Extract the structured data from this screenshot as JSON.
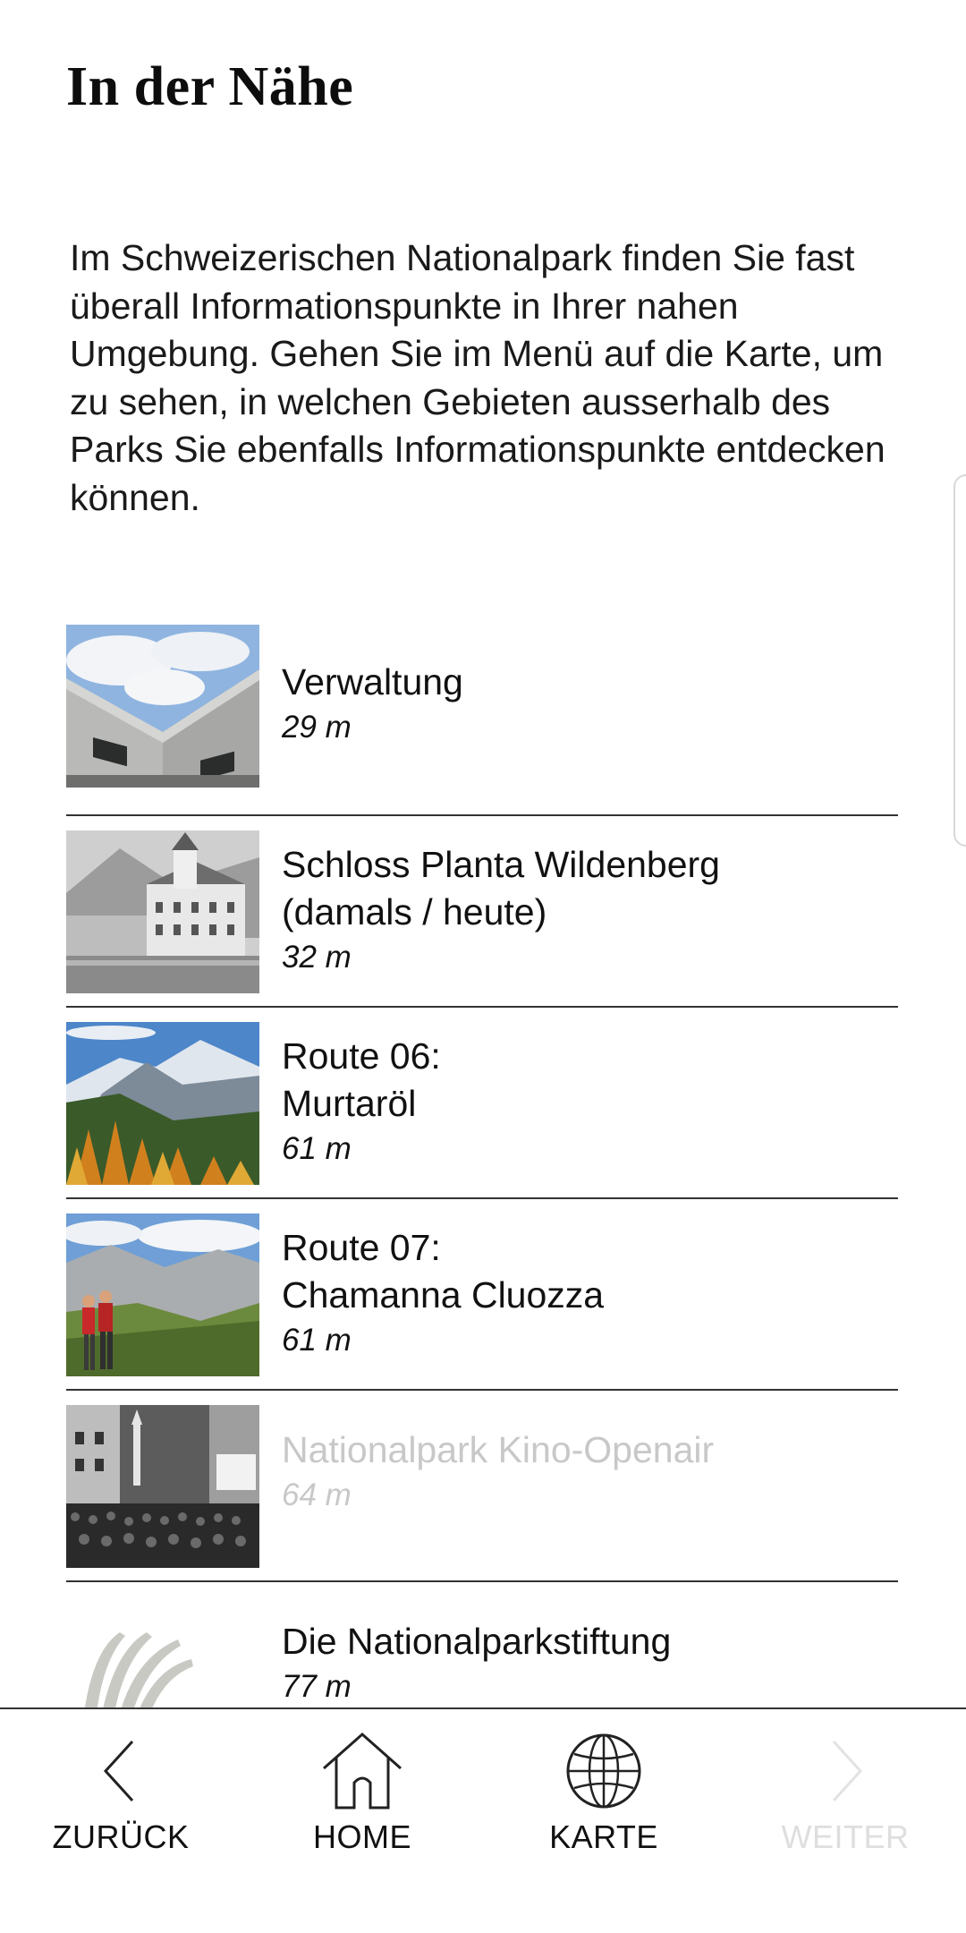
{
  "header": {
    "title": "In der Nähe"
  },
  "intro": "Im Schweizerischen Nationalpark finden Sie fast überall Informationspunkte in Ihrer nahen Umgebung. Gehen Sie im Menü auf die Karte, um zu sehen, in welchen Gebieten ausserhalb des Parks Sie ebenfalls Informationspunkte entdecken können.",
  "list": {
    "items": [
      {
        "title": "Verwaltung",
        "distance": "29 m",
        "image": "building-architecture-photo",
        "enabled": true
      },
      {
        "title": "Schloss Planta Wildenberg\n(damals / heute)",
        "distance": "32 m",
        "image": "castle-historic-photo",
        "enabled": true
      },
      {
        "title": "Route 06:\nMurtaröl",
        "distance": "61 m",
        "image": "mountain-autumn-photo",
        "enabled": true
      },
      {
        "title": "Route 07:\nChamanna Cluozza",
        "distance": "61 m",
        "image": "hikers-valley-photo",
        "enabled": true
      },
      {
        "title": "Nationalpark Kino-Openair",
        "distance": "64 m",
        "image": "open-air-cinema-photo",
        "enabled": false
      },
      {
        "title": "Die Nationalparkstiftung",
        "distance": "77 m",
        "image": "foundation-logo",
        "enabled": true
      }
    ]
  },
  "nav": {
    "back": {
      "label": "ZURÜCK",
      "icon": "chevron-left-icon",
      "enabled": true
    },
    "home": {
      "label": "HOME",
      "icon": "home-icon",
      "enabled": true
    },
    "map": {
      "label": "KARTE",
      "icon": "globe-icon",
      "enabled": true
    },
    "next": {
      "label": "WEITER",
      "icon": "chevron-right-icon",
      "enabled": false
    }
  },
  "colors": {
    "text": "#111111",
    "disabled": "#c8c8c8",
    "divider": "#333333",
    "background": "#ffffff"
  }
}
